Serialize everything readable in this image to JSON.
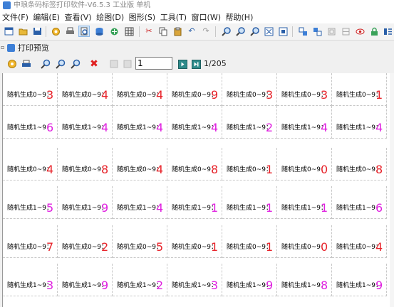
{
  "window": {
    "title": "中琅条码标签打印软件-V6.5.3 工业版 单机"
  },
  "menu": [
    {
      "label": "文件(F)"
    },
    {
      "label": "编辑(E)"
    },
    {
      "label": "查看(V)"
    },
    {
      "label": "绘图(D)"
    },
    {
      "label": "图形(S)"
    },
    {
      "label": "工具(T)"
    },
    {
      "label": "窗口(W)"
    },
    {
      "label": "帮助(H)"
    }
  ],
  "toolbar_icons": [
    "new-icon",
    "open-icon",
    "save-icon",
    "settings-icon",
    "print-icon",
    "print-preview-icon",
    "database-icon",
    "data-source-icon",
    "grid-icon",
    "cut-icon",
    "copy-icon",
    "paste-icon",
    "undo-icon",
    "redo-icon",
    "zoom-in-icon",
    "zoom-out-icon",
    "zoom-actual-icon",
    "zoom-fit-icon",
    "zoom-page-icon",
    "group-icon",
    "ungroup-icon",
    "align-icon",
    "distribute-icon",
    "eye-icon",
    "lock-icon",
    "layers-icon"
  ],
  "preview": {
    "title": "打印预览",
    "page_value": "1",
    "page_total": "1/205"
  },
  "grid": {
    "label_0_9": "随机生成0~9：",
    "label_1_9": "随机生成1~9：",
    "colors": {
      "red": "#e8242b",
      "magenta": "#e020e0"
    },
    "rows": [
      {
        "type": "0_9",
        "values": [
          "3",
          "4",
          "4",
          "9",
          "3",
          "3",
          "1"
        ]
      },
      {
        "type": "1_9",
        "values": [
          "6",
          "4",
          "4",
          "4",
          "2",
          "4",
          "4"
        ]
      },
      {
        "type": "0_9",
        "values": [
          "4",
          "8",
          "4",
          "8",
          "1",
          "0",
          "8"
        ]
      },
      {
        "type": "1_9",
        "values": [
          "5",
          "9",
          "4",
          "1",
          "1",
          "1",
          "6"
        ]
      },
      {
        "type": "0_9",
        "values": [
          "7",
          "2",
          "5",
          "1",
          "1",
          "0",
          "4"
        ]
      },
      {
        "type": "1_9",
        "values": [
          "3",
          "9",
          "2",
          "3",
          "9",
          "8",
          "9"
        ]
      }
    ]
  }
}
